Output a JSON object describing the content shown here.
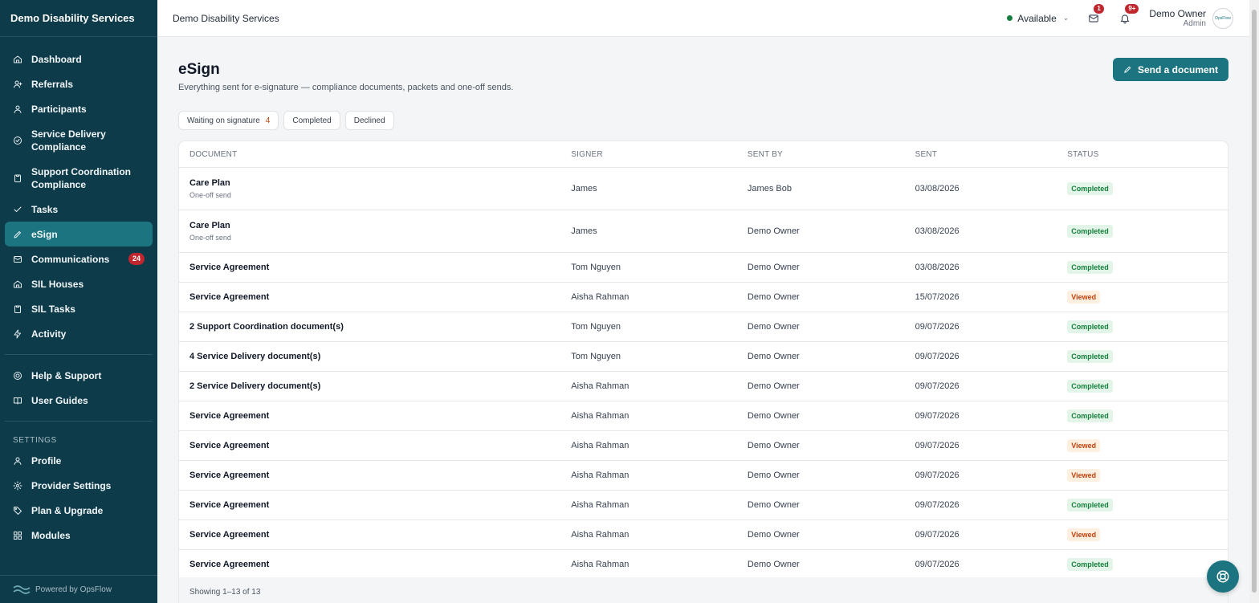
{
  "app": {
    "brand": "Demo Disability Services",
    "powered_by": "Powered by OpsFlow"
  },
  "sidebar": {
    "items": [
      {
        "key": "dashboard",
        "label": "Dashboard",
        "icon": "home-icon"
      },
      {
        "key": "referrals",
        "label": "Referrals",
        "icon": "user-plus-icon"
      },
      {
        "key": "participants",
        "label": "Participants",
        "icon": "user-icon"
      },
      {
        "key": "service-delivery-compliance",
        "label": "Service Delivery Compliance",
        "icon": "check-circle-icon"
      },
      {
        "key": "support-coordination-compliance",
        "label": "Support Coordination Compliance",
        "icon": "clipboard-icon"
      },
      {
        "key": "tasks",
        "label": "Tasks",
        "icon": "check-icon"
      },
      {
        "key": "esign",
        "label": "eSign",
        "icon": "pen-icon",
        "active": true
      },
      {
        "key": "communications",
        "label": "Communications",
        "icon": "mail-icon",
        "badge": "24"
      },
      {
        "key": "sil-houses",
        "label": "SIL Houses",
        "icon": "home-icon"
      },
      {
        "key": "sil-tasks",
        "label": "SIL Tasks",
        "icon": "clipboard-icon"
      },
      {
        "key": "activity",
        "label": "Activity",
        "icon": "bolt-icon"
      }
    ],
    "support_items": [
      {
        "key": "help-support",
        "label": "Help & Support",
        "icon": "lifebuoy-icon"
      },
      {
        "key": "user-guides",
        "label": "User Guides",
        "icon": "book-icon"
      }
    ],
    "settings_label": "SETTINGS",
    "settings_items": [
      {
        "key": "profile",
        "label": "Profile",
        "icon": "user-icon"
      },
      {
        "key": "provider-settings",
        "label": "Provider Settings",
        "icon": "gear-icon"
      },
      {
        "key": "plan-upgrade",
        "label": "Plan & Upgrade",
        "icon": "tag-icon"
      },
      {
        "key": "modules",
        "label": "Modules",
        "icon": "grid-icon"
      }
    ]
  },
  "topbar": {
    "title": "Demo Disability Services",
    "status": "Available",
    "status_color": "#15803d",
    "mail_count": "1",
    "notif_count": "9+",
    "user_name": "Demo Owner",
    "user_role": "Admin",
    "avatar_text": "OpsFlow"
  },
  "page": {
    "title": "eSign",
    "subtitle": "Everything sent for e-signature — compliance documents, packets and one-off sends.",
    "send_button": "Send a document",
    "filters": [
      {
        "label": "Waiting on signature",
        "count": "4"
      },
      {
        "label": "Completed"
      },
      {
        "label": "Declined"
      }
    ]
  },
  "table": {
    "columns": [
      "DOCUMENT",
      "SIGNER",
      "SENT BY",
      "SENT",
      "STATUS"
    ],
    "rows": [
      {
        "document": "Care Plan",
        "sub": "One-off send",
        "signer": "James",
        "sent_by": "James Bob",
        "sent": "03/08/2026",
        "status": "Completed"
      },
      {
        "document": "Care Plan",
        "sub": "One-off send",
        "signer": "James",
        "sent_by": "Demo Owner",
        "sent": "03/08/2026",
        "status": "Completed"
      },
      {
        "document": "Service Agreement",
        "signer": "Tom Nguyen",
        "sent_by": "Demo Owner",
        "sent": "03/08/2026",
        "status": "Completed"
      },
      {
        "document": "Service Agreement",
        "signer": "Aisha Rahman",
        "sent_by": "Demo Owner",
        "sent": "15/07/2026",
        "status": "Viewed"
      },
      {
        "document": "2 Support Coordination document(s)",
        "signer": "Tom Nguyen",
        "sent_by": "Demo Owner",
        "sent": "09/07/2026",
        "status": "Completed"
      },
      {
        "document": "4 Service Delivery document(s)",
        "signer": "Tom Nguyen",
        "sent_by": "Demo Owner",
        "sent": "09/07/2026",
        "status": "Completed"
      },
      {
        "document": "2 Service Delivery document(s)",
        "signer": "Aisha Rahman",
        "sent_by": "Demo Owner",
        "sent": "09/07/2026",
        "status": "Completed"
      },
      {
        "document": "Service Agreement",
        "signer": "Aisha Rahman",
        "sent_by": "Demo Owner",
        "sent": "09/07/2026",
        "status": "Completed"
      },
      {
        "document": "Service Agreement",
        "signer": "Aisha Rahman",
        "sent_by": "Demo Owner",
        "sent": "09/07/2026",
        "status": "Viewed"
      },
      {
        "document": "Service Agreement",
        "signer": "Aisha Rahman",
        "sent_by": "Demo Owner",
        "sent": "09/07/2026",
        "status": "Viewed"
      },
      {
        "document": "Service Agreement",
        "signer": "Aisha Rahman",
        "sent_by": "Demo Owner",
        "sent": "09/07/2026",
        "status": "Completed"
      },
      {
        "document": "Service Agreement",
        "signer": "Aisha Rahman",
        "sent_by": "Demo Owner",
        "sent": "09/07/2026",
        "status": "Viewed"
      },
      {
        "document": "Service Agreement",
        "signer": "Aisha Rahman",
        "sent_by": "Demo Owner",
        "sent": "09/07/2026",
        "status": "Completed"
      }
    ],
    "footer": "Showing 1–13 of 13"
  },
  "colors": {
    "sidebar_bg": "#0e3b4a",
    "accent": "#1c7480",
    "badge_red": "#c0262d",
    "completed": "#15803d",
    "viewed": "#c2410c"
  }
}
